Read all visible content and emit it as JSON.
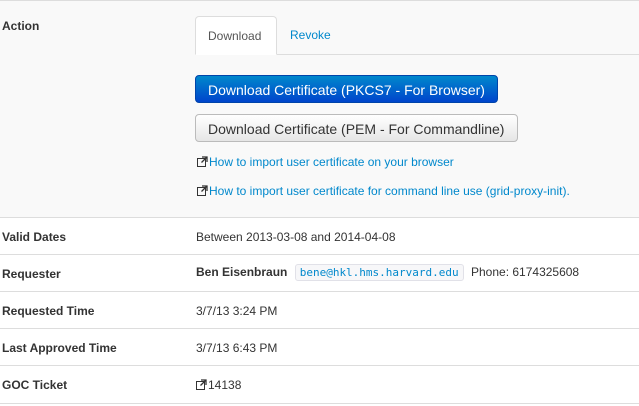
{
  "action": {
    "label": "Action",
    "tabs": [
      {
        "label": "Download",
        "active": true
      },
      {
        "label": "Revoke",
        "active": false
      }
    ],
    "buttons": {
      "download_pkcs7": "Download Certificate (PKCS7 - For Browser)",
      "download_pem": "Download Certificate (PEM - For Commandline)"
    },
    "links": {
      "browser_import": "How to import user certificate on your browser",
      "cmdline_import": "How to import user certificate for command line use (grid-proxy-init)."
    }
  },
  "valid_dates": {
    "label": "Valid Dates",
    "value": "Between 2013-03-08 and 2014-04-08"
  },
  "requester": {
    "label": "Requester",
    "name": "Ben Eisenbraun",
    "email": "bene@hkl.hms.harvard.edu",
    "phone": "Phone: 6174325608"
  },
  "requested_time": {
    "label": "Requested Time",
    "value": "3/7/13 3:24 PM"
  },
  "last_approved_time": {
    "label": "Last Approved Time",
    "value": "3/7/13 6:43 PM"
  },
  "goc_ticket": {
    "label": "GOC Ticket",
    "value": "14138"
  },
  "icons": {
    "external_link": "external-link-icon"
  },
  "colors": {
    "link": "#0088cc",
    "primary_button": "#0055cc",
    "border": "#dddddd"
  }
}
